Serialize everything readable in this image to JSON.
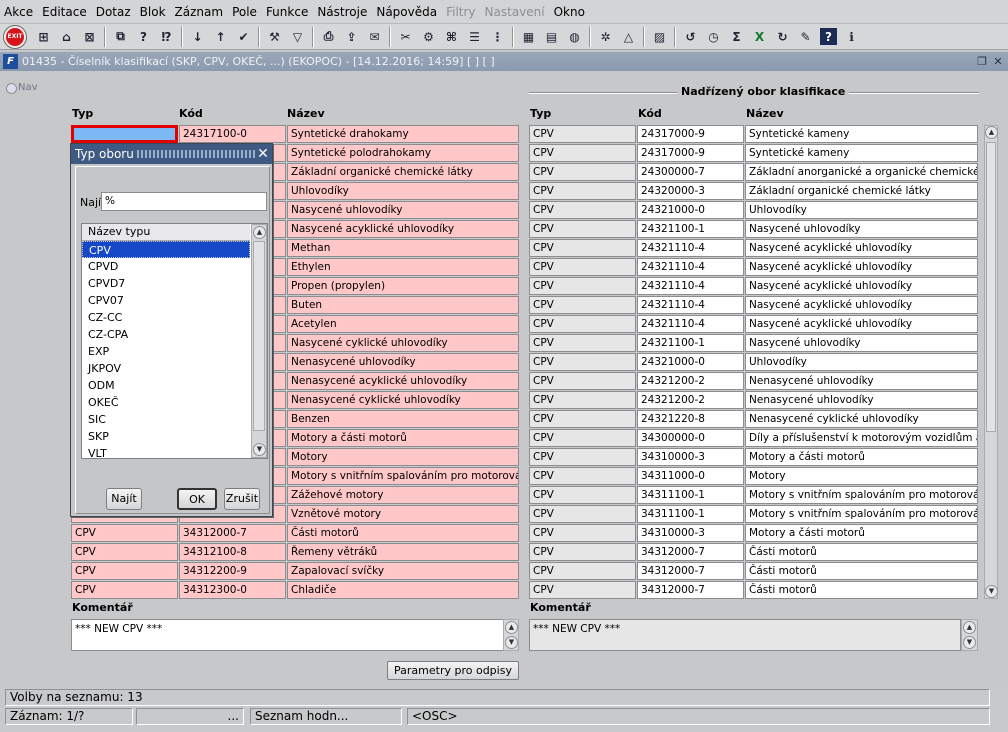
{
  "menubar": {
    "items": [
      {
        "label": "Akce",
        "disabled": false
      },
      {
        "label": "Editace",
        "disabled": false
      },
      {
        "label": "Dotaz",
        "disabled": false
      },
      {
        "label": "Blok",
        "disabled": false
      },
      {
        "label": "Záznam",
        "disabled": false
      },
      {
        "label": "Pole",
        "disabled": false
      },
      {
        "label": "Funkce",
        "disabled": false
      },
      {
        "label": "Nástroje",
        "disabled": false
      },
      {
        "label": "Nápověda",
        "disabled": false
      },
      {
        "label": "Filtry",
        "disabled": true
      },
      {
        "label": "Nastavení",
        "disabled": true
      },
      {
        "label": "Okno",
        "disabled": false
      }
    ]
  },
  "toolbar": {
    "exit_label": "EXIT",
    "icons": [
      "insert-record-icon",
      "save-record-icon",
      "delete-record-icon",
      "copy-record-icon",
      "query-icon",
      "execute-query-icon",
      "sort-asc-icon",
      "sort-desc-icon",
      "accept-icon",
      "tools-icon",
      "filter-icon",
      "print-icon",
      "export-icon",
      "mail-icon",
      "cut-icon",
      "config-icon",
      "help-tree-icon",
      "list-icon",
      "tree-icon",
      "calendar-icon",
      "document-icon",
      "globe-icon",
      "settings-icon",
      "triangle-icon",
      "image-icon",
      "history-icon",
      "clock-icon",
      "sum-icon",
      "excel-icon",
      "refresh-icon",
      "tools2-icon",
      "question-icon",
      "info-icon"
    ]
  },
  "window": {
    "title": "01435 - Číselník klasifikací (SKP, CPV, OKEČ, ...) (EKOPOC) - [14.12.2016; 14:59]  [ ]  [ ]",
    "nav_label": "Nav"
  },
  "left_table": {
    "headers": {
      "typ": "Typ",
      "kod": "Kód",
      "nazev": "Název"
    },
    "rows": [
      {
        "typ": "",
        "kod": "24317100-0",
        "nazev": "Syntetické drahokamy"
      },
      {
        "typ": "",
        "kod": "",
        "nazev": "Syntetické polodrahokamy"
      },
      {
        "typ": "",
        "kod": "",
        "nazev": "Základní organické chemické látky"
      },
      {
        "typ": "",
        "kod": "",
        "nazev": "Uhlovodíky"
      },
      {
        "typ": "",
        "kod": "",
        "nazev": "Nasycené uhlovodíky"
      },
      {
        "typ": "",
        "kod": "",
        "nazev": "Nasycené acyklické uhlovodíky"
      },
      {
        "typ": "",
        "kod": "",
        "nazev": "Methan"
      },
      {
        "typ": "",
        "kod": "",
        "nazev": "Ethylen"
      },
      {
        "typ": "",
        "kod": "",
        "nazev": "Propen (propylen)"
      },
      {
        "typ": "",
        "kod": "",
        "nazev": "Buten"
      },
      {
        "typ": "",
        "kod": "",
        "nazev": "Acetylen"
      },
      {
        "typ": "",
        "kod": "",
        "nazev": "Nasycené cyklické uhlovodíky"
      },
      {
        "typ": "",
        "kod": "",
        "nazev": "Nenasycené uhlovodíky"
      },
      {
        "typ": "",
        "kod": "",
        "nazev": "Nenasycené acyklické uhlovodíky"
      },
      {
        "typ": "",
        "kod": "",
        "nazev": "Nenasycené cyklické uhlovodíky"
      },
      {
        "typ": "",
        "kod": "",
        "nazev": "Benzen"
      },
      {
        "typ": "",
        "kod": "",
        "nazev": "Motory a části motorů"
      },
      {
        "typ": "",
        "kod": "",
        "nazev": "Motory"
      },
      {
        "typ": "",
        "kod": "",
        "nazev": "Motory s vnitřním spalováním pro motorová voz"
      },
      {
        "typ": "",
        "kod": "",
        "nazev": "Zážehové motory"
      },
      {
        "typ": "",
        "kod": "",
        "nazev": "Vznětové motory"
      },
      {
        "typ": "CPV",
        "kod": "34312000-7",
        "nazev": "Části motorů"
      },
      {
        "typ": "CPV",
        "kod": "34312100-8",
        "nazev": "Řemeny větráků"
      },
      {
        "typ": "CPV",
        "kod": "34312200-9",
        "nazev": "Zapalovací svíčky"
      },
      {
        "typ": "CPV",
        "kod": "34312300-0",
        "nazev": "Chladiče"
      }
    ],
    "comment_label": "Komentář",
    "comment_value": "*** NEW CPV ***"
  },
  "right_table": {
    "group_title": "Nadřízený obor klasifikace",
    "headers": {
      "typ": "Typ",
      "kod": "Kód",
      "nazev": "Název"
    },
    "rows": [
      {
        "typ": "CPV",
        "kod": "24317000-9",
        "nazev": "Syntetické kameny"
      },
      {
        "typ": "CPV",
        "kod": "24317000-9",
        "nazev": "Syntetické kameny"
      },
      {
        "typ": "CPV",
        "kod": "24300000-7",
        "nazev": "Základní anorganické a organické chemické látk"
      },
      {
        "typ": "CPV",
        "kod": "24320000-3",
        "nazev": "Základní organické chemické látky"
      },
      {
        "typ": "CPV",
        "kod": "24321000-0",
        "nazev": "Uhlovodíky"
      },
      {
        "typ": "CPV",
        "kod": "24321100-1",
        "nazev": "Nasycené uhlovodíky"
      },
      {
        "typ": "CPV",
        "kod": "24321110-4",
        "nazev": "Nasycené acyklické uhlovodíky"
      },
      {
        "typ": "CPV",
        "kod": "24321110-4",
        "nazev": "Nasycené acyklické uhlovodíky"
      },
      {
        "typ": "CPV",
        "kod": "24321110-4",
        "nazev": "Nasycené acyklické uhlovodíky"
      },
      {
        "typ": "CPV",
        "kod": "24321110-4",
        "nazev": "Nasycené acyklické uhlovodíky"
      },
      {
        "typ": "CPV",
        "kod": "24321110-4",
        "nazev": "Nasycené acyklické uhlovodíky"
      },
      {
        "typ": "CPV",
        "kod": "24321100-1",
        "nazev": "Nasycené uhlovodíky"
      },
      {
        "typ": "CPV",
        "kod": "24321000-0",
        "nazev": "Uhlovodíky"
      },
      {
        "typ": "CPV",
        "kod": "24321200-2",
        "nazev": "Nenasycené uhlovodíky"
      },
      {
        "typ": "CPV",
        "kod": "24321200-2",
        "nazev": "Nenasycené uhlovodíky"
      },
      {
        "typ": "CPV",
        "kod": "24321220-8",
        "nazev": "Nenasycené cyklické uhlovodíky"
      },
      {
        "typ": "CPV",
        "kod": "34300000-0",
        "nazev": "Díly a příslušenství k motorovým vozidlům a mot"
      },
      {
        "typ": "CPV",
        "kod": "34310000-3",
        "nazev": "Motory a části motorů"
      },
      {
        "typ": "CPV",
        "kod": "34311000-0",
        "nazev": "Motory"
      },
      {
        "typ": "CPV",
        "kod": "34311100-1",
        "nazev": "Motory s vnitřním spalováním pro motorová vozi"
      },
      {
        "typ": "CPV",
        "kod": "34311100-1",
        "nazev": "Motory s vnitřním spalováním pro motorová vozi"
      },
      {
        "typ": "CPV",
        "kod": "34310000-3",
        "nazev": "Motory a části motorů"
      },
      {
        "typ": "CPV",
        "kod": "34312000-7",
        "nazev": "Části motorů"
      },
      {
        "typ": "CPV",
        "kod": "34312000-7",
        "nazev": "Části motorů"
      },
      {
        "typ": "CPV",
        "kod": "34312000-7",
        "nazev": "Části motorů"
      }
    ],
    "comment_label": "Komentář",
    "comment_value": "*** NEW CPV ***"
  },
  "params_button": "Parametry pro odpisy",
  "dialog": {
    "title": "Typ oboru",
    "search_label": "Najít",
    "search_value": "%",
    "list_header": "Název typu",
    "items": [
      "CPV",
      "CPVD",
      "CPVD7",
      "CPV07",
      "CZ-CC",
      "CZ-CPA",
      "EXP",
      "JKPOV",
      "ODM",
      "OKEČ",
      "SIC",
      "SKP",
      "VLT"
    ],
    "selected": "CPV",
    "find_button": "Najít",
    "ok_button": "OK",
    "cancel_button": "Zrušit"
  },
  "status": {
    "message": "Volby na seznamu: 13",
    "record": "Záznam: 1/?",
    "dots": "...",
    "list_values": "Seznam hodn...",
    "osc": "<OSC>"
  },
  "colors": {
    "pink_row": "#ffc7c8",
    "selected_cell": "#7fb9f5",
    "current_record_border": "#e00000",
    "dialog_title": "#3e5a82",
    "list_selection": "#1448c6"
  }
}
